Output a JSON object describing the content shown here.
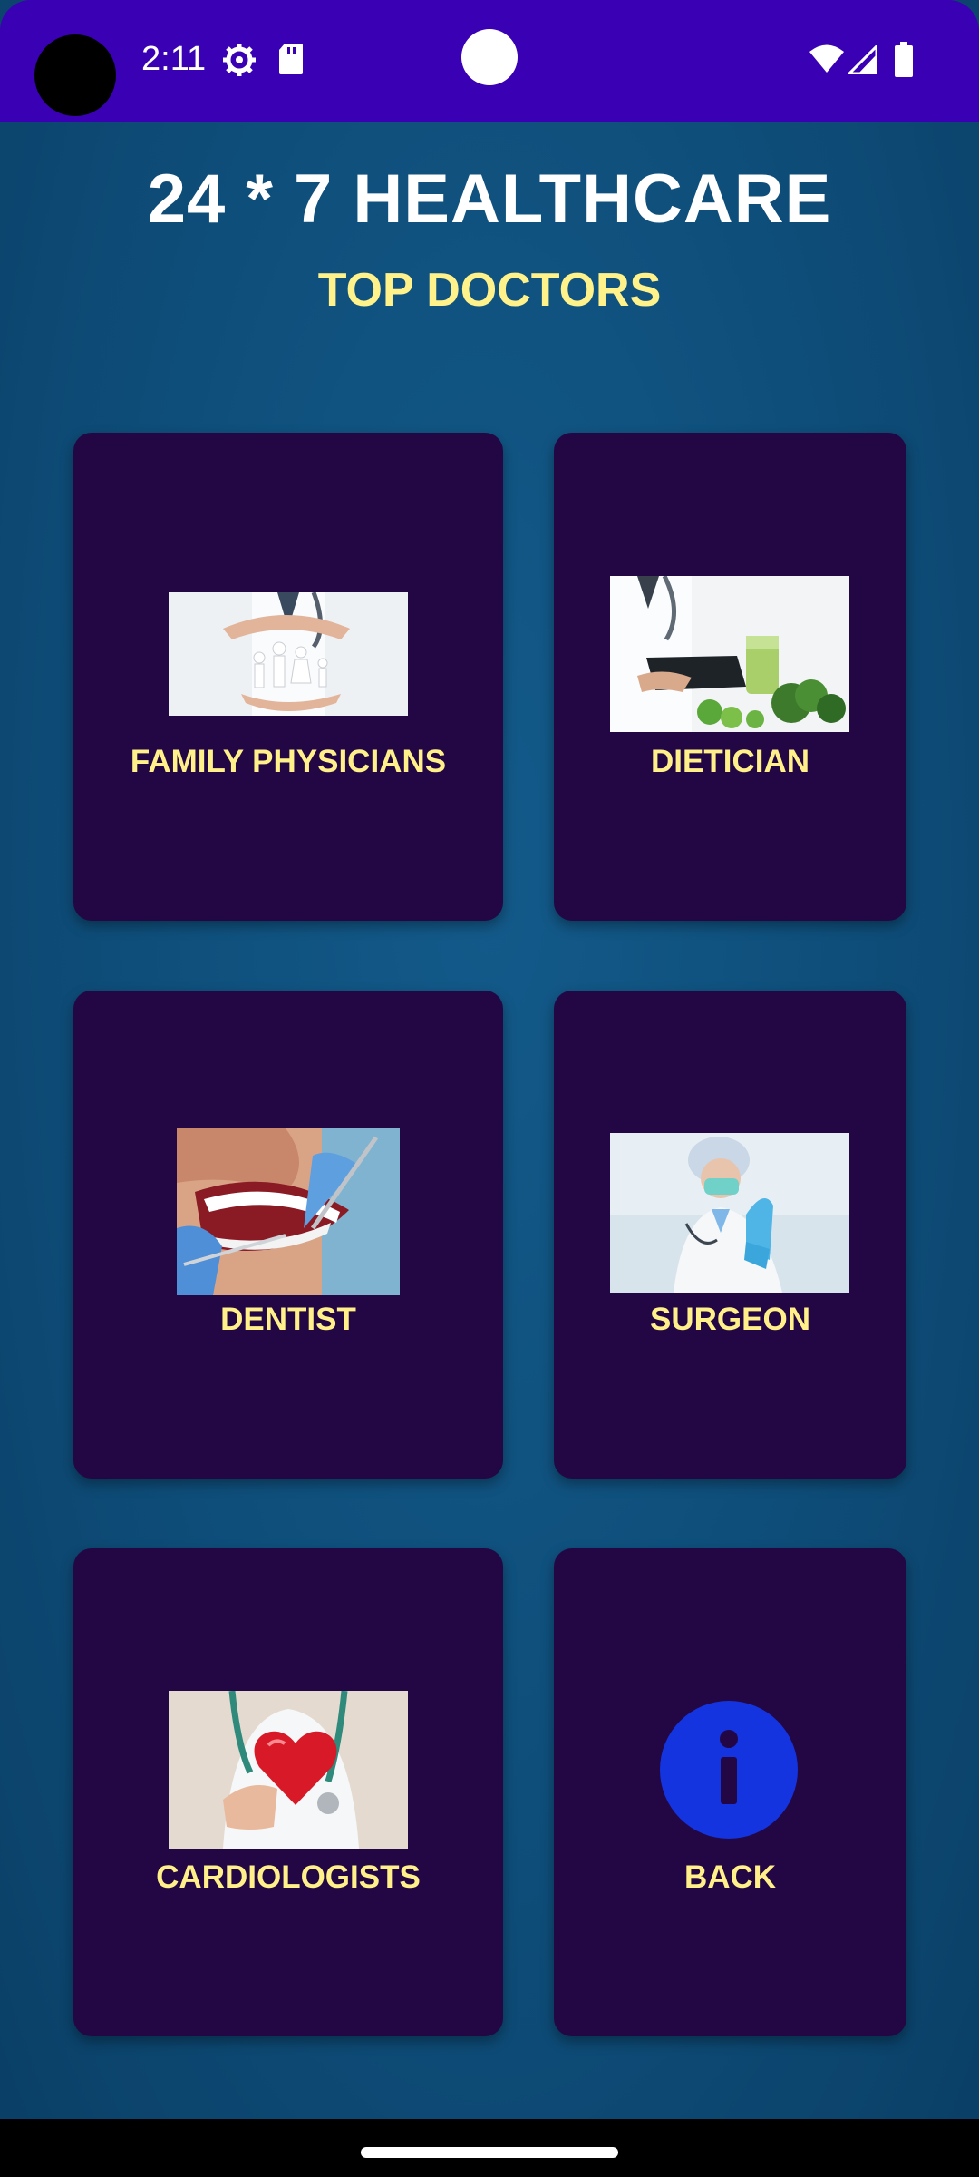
{
  "status_bar": {
    "time": "2:11",
    "icons": [
      "settings-gear-icon",
      "sd-card-icon",
      "wifi-icon",
      "cellular-signal-icon",
      "battery-icon"
    ]
  },
  "header": {
    "title": "24 * 7 HEALTHCARE",
    "subtitle": "TOP DOCTORS"
  },
  "cards": [
    {
      "label": "FAMILY PHYSICIANS",
      "image": "family-care-photo"
    },
    {
      "label": "DIETICIAN",
      "image": "dietician-photo"
    },
    {
      "label": "DENTIST",
      "image": "dentist-photo"
    },
    {
      "label": "SURGEON",
      "image": "surgeon-photo"
    },
    {
      "label": "CARDIOLOGISTS",
      "image": "cardiologist-photo"
    },
    {
      "label": "BACK",
      "image": "info-icon"
    }
  ],
  "colors": {
    "status_bar": "#3a00b3",
    "background": "#0f4f7d",
    "card": "#220744",
    "label": "#fff08a",
    "info_circle": "#1434e0"
  }
}
